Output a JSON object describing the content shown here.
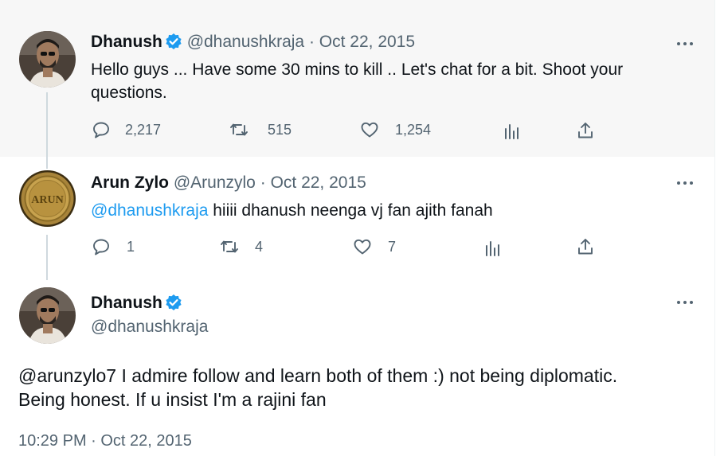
{
  "tweets": [
    {
      "name": "Dhanush",
      "verified": true,
      "handle": "@dhanushkraja",
      "separator": "·",
      "date": "Oct 22, 2015",
      "text": "Hello guys ... Have some 30 mins to kill .. Let's chat for a bit. Shoot your questions.",
      "replies": "2,217",
      "retweets": "515",
      "likes": "1,254"
    },
    {
      "name": "Arun Zylo",
      "verified": false,
      "handle": "@Arunzylo",
      "separator": "·",
      "date": "Oct 22, 2015",
      "mention": "@dhanushkraja",
      "text": " hiiii dhanush neenga vj fan ajith fanah",
      "avatar_text": "ARUN",
      "replies": "1",
      "retweets": "4",
      "likes": "7"
    }
  ],
  "main_tweet": {
    "name": "Dhanush",
    "verified": true,
    "handle": "@dhanushkraja",
    "text": "@arunzylo7 I admire follow and learn both of them :) not being diplomatic. Being honest. If u insist I'm a rajini fan",
    "timestamp": "10:29 PM · Oct 22, 2015"
  },
  "colors": {
    "accent": "#1d9bf0",
    "secondary_text": "#536471",
    "highlight_bg": "#f7f7f7"
  }
}
